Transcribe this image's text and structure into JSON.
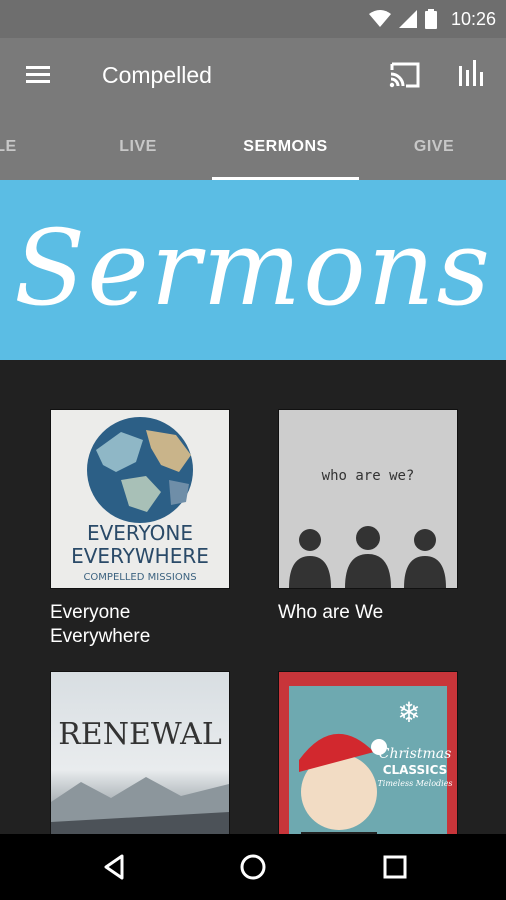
{
  "status_bar": {
    "time": "10:26"
  },
  "app_bar": {
    "title": "Compelled"
  },
  "tabs": [
    {
      "label": "LE",
      "active": false
    },
    {
      "label": "LIVE",
      "active": false
    },
    {
      "label": "SERMONS",
      "active": true
    },
    {
      "label": "GIVE",
      "active": false
    }
  ],
  "banner": {
    "text": "Sermons"
  },
  "series": [
    {
      "title": "Everyone Everywhere",
      "art_text": [
        "EVERYONE",
        "EVERYWHERE",
        "COMPELLED MISSIONS"
      ]
    },
    {
      "title": "Who are We",
      "art_text": [
        "who are we?"
      ]
    },
    {
      "title": "",
      "art_text": [
        "RENEWAL"
      ]
    },
    {
      "title": "",
      "art_text": [
        "Christmas",
        "CLASSICS",
        "Timeless Melodies"
      ]
    }
  ],
  "colors": {
    "app_bar": "#7a7a7a",
    "status_bar": "#6e6e6e",
    "banner": "#5bbde4",
    "background": "#212121"
  }
}
